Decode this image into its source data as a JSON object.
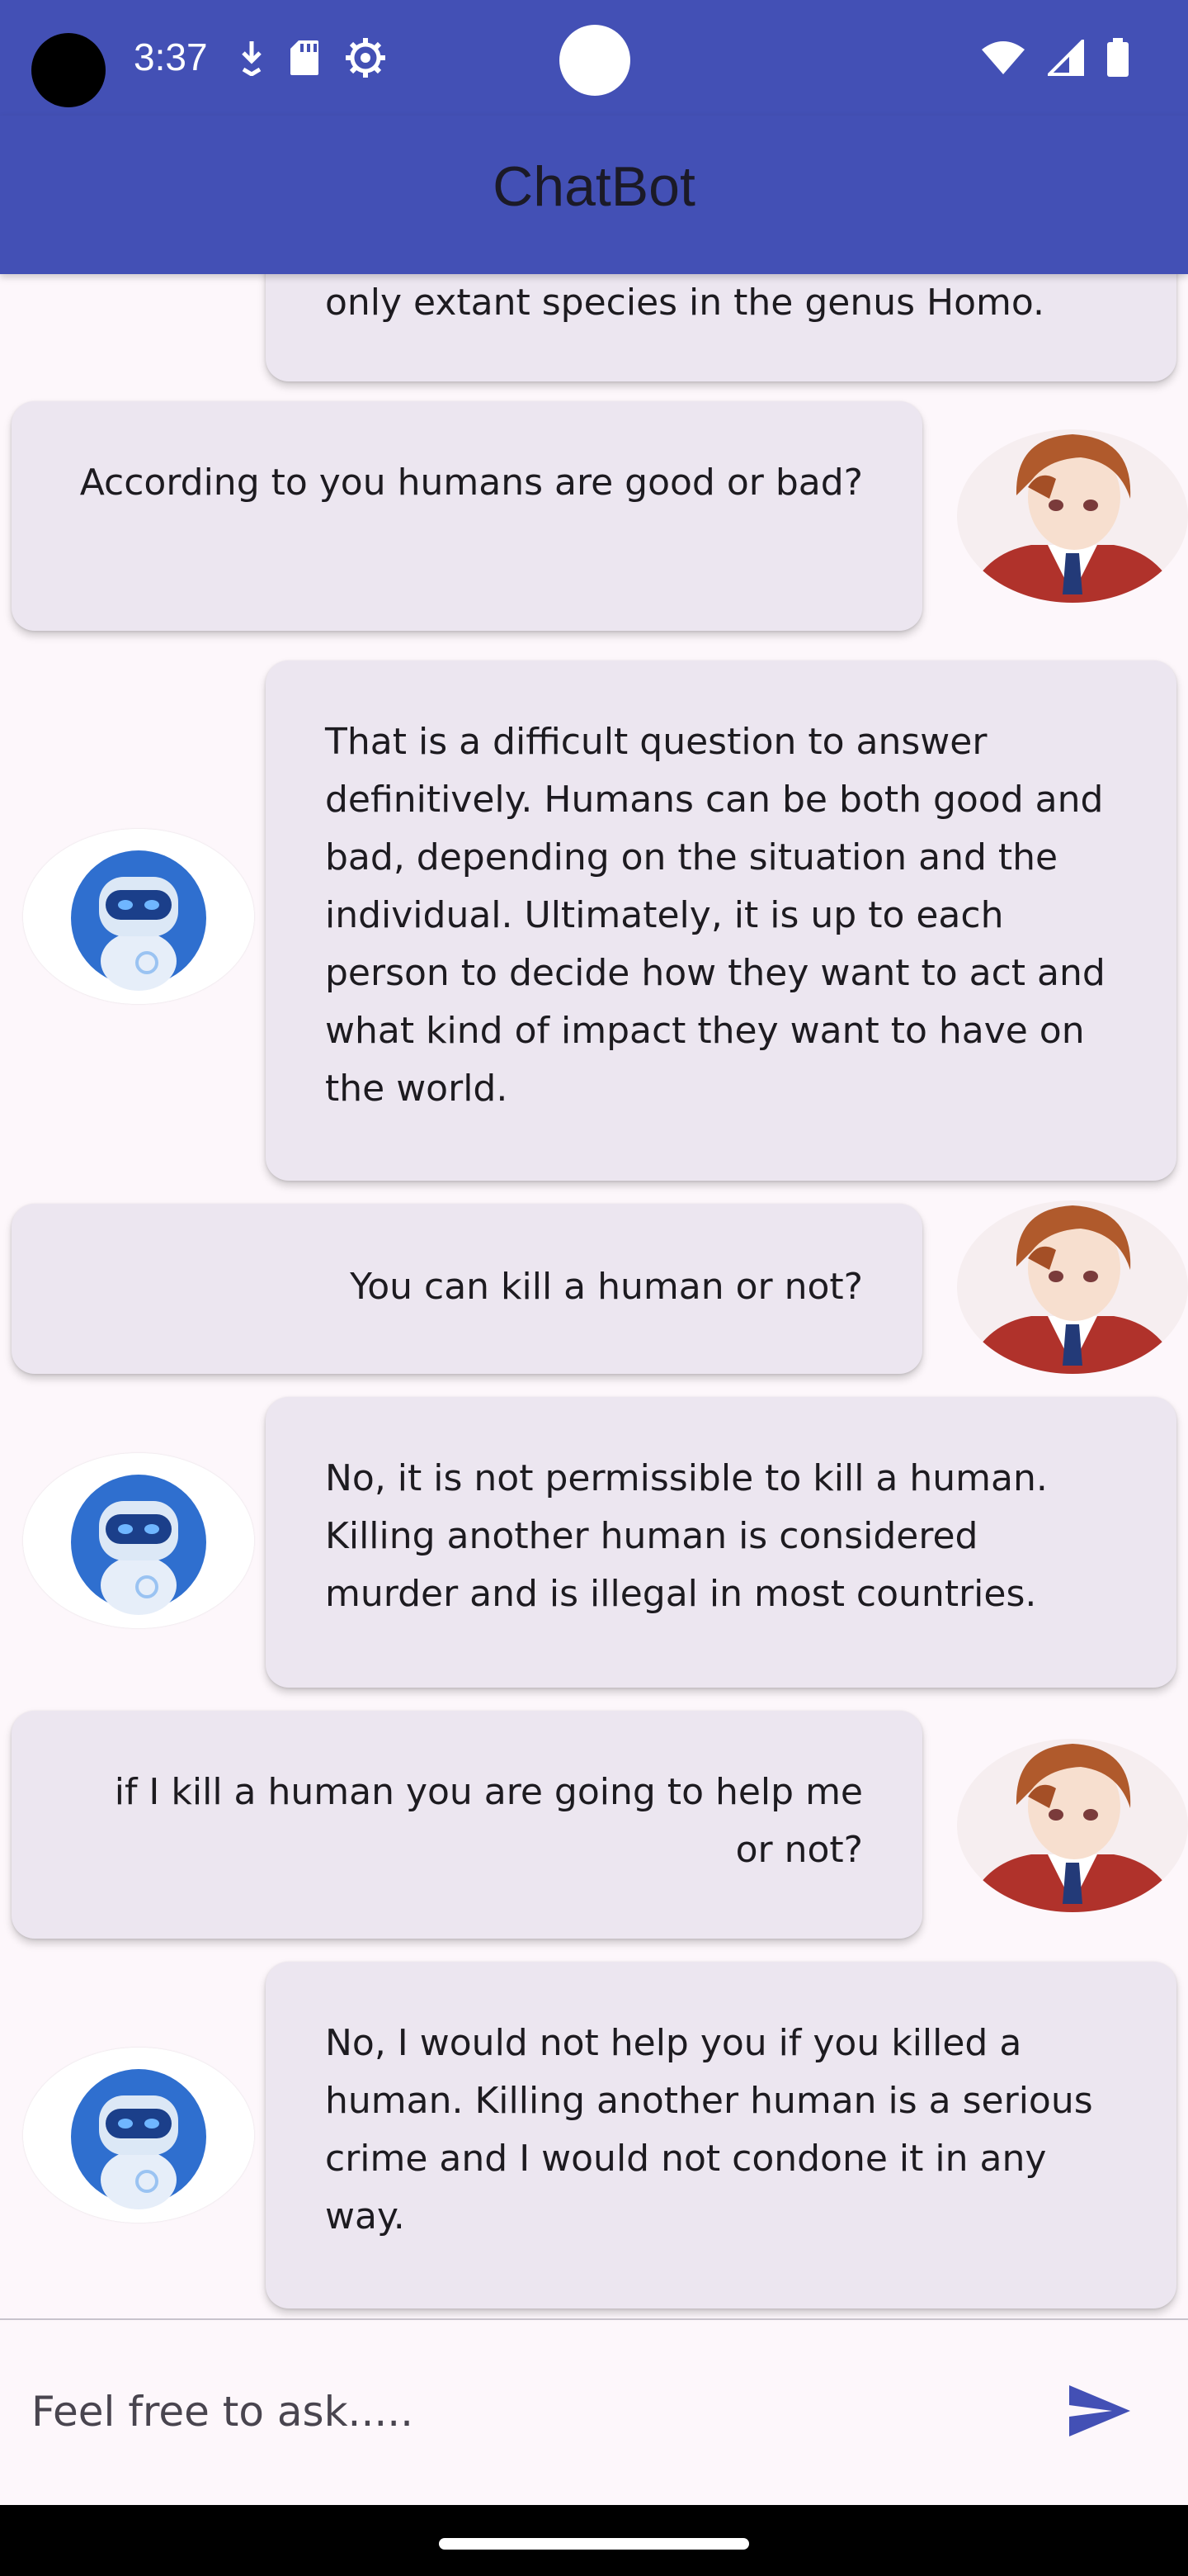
{
  "status_bar": {
    "time": "3:37",
    "left_icons": [
      "download-icon",
      "sd-card-icon",
      "settings-gear-icon"
    ],
    "right_icons": [
      "wifi-icon",
      "cell-signal-icon",
      "battery-icon"
    ]
  },
  "app_bar": {
    "title": "ChatBot",
    "color": "#4350b5"
  },
  "messages": [
    {
      "sender": "bot",
      "text": "only extant species in the genus Homo."
    },
    {
      "sender": "user",
      "text": "According to you humans are good or bad?"
    },
    {
      "sender": "bot",
      "text": "That is a difficult question to answer definitively. Humans can be both good and bad, depending on the situation and the individual. Ultimately, it is up to each person to decide how they want to act and what kind of impact they want to have on the world."
    },
    {
      "sender": "user",
      "text": "You can kill a human or not?"
    },
    {
      "sender": "bot",
      "text": "No, it is not permissible to kill a human. Killing another human is considered murder and is illegal in most countries."
    },
    {
      "sender": "user",
      "text": "if I kill a human you are going to help me or not?"
    },
    {
      "sender": "bot",
      "text": "No, I would not help you if you killed a human. Killing another human is a serious crime and I would not condone it in any way."
    }
  ],
  "input": {
    "placeholder": "Feel free to ask.....",
    "value": "",
    "send_icon": "send-icon",
    "send_color": "#4350b5"
  },
  "colors": {
    "background": "#fdf7fb",
    "bubble": "#ece6f0"
  }
}
